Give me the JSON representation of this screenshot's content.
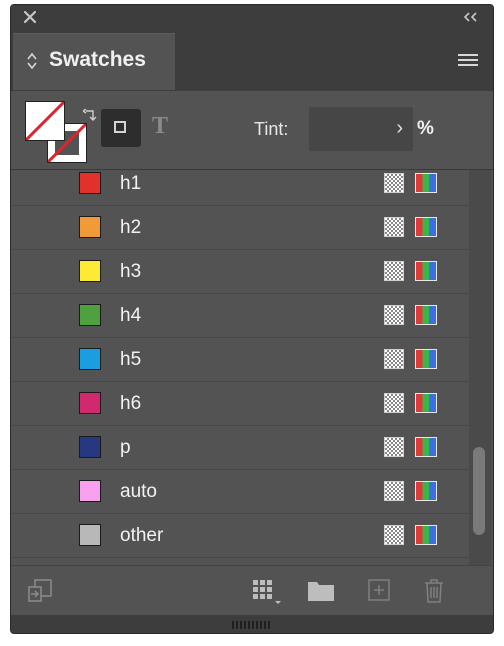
{
  "panel": {
    "tab_label": "Swatches",
    "controls": {
      "tint_label": "Tint:",
      "tint_value": "",
      "percent": "%"
    },
    "swatches": [
      {
        "name": "h1",
        "color": "#e0322b"
      },
      {
        "name": "h2",
        "color": "#f19a38"
      },
      {
        "name": "h3",
        "color": "#fbea36"
      },
      {
        "name": "h4",
        "color": "#4fa13f"
      },
      {
        "name": "h5",
        "color": "#1a9ee0"
      },
      {
        "name": "h6",
        "color": "#d1286e"
      },
      {
        "name": "p",
        "color": "#26387f"
      },
      {
        "name": "auto",
        "color": "#f7a0f0"
      },
      {
        "name": "other",
        "color": "#b8b8b8"
      }
    ],
    "scroll_position": 0.85
  }
}
